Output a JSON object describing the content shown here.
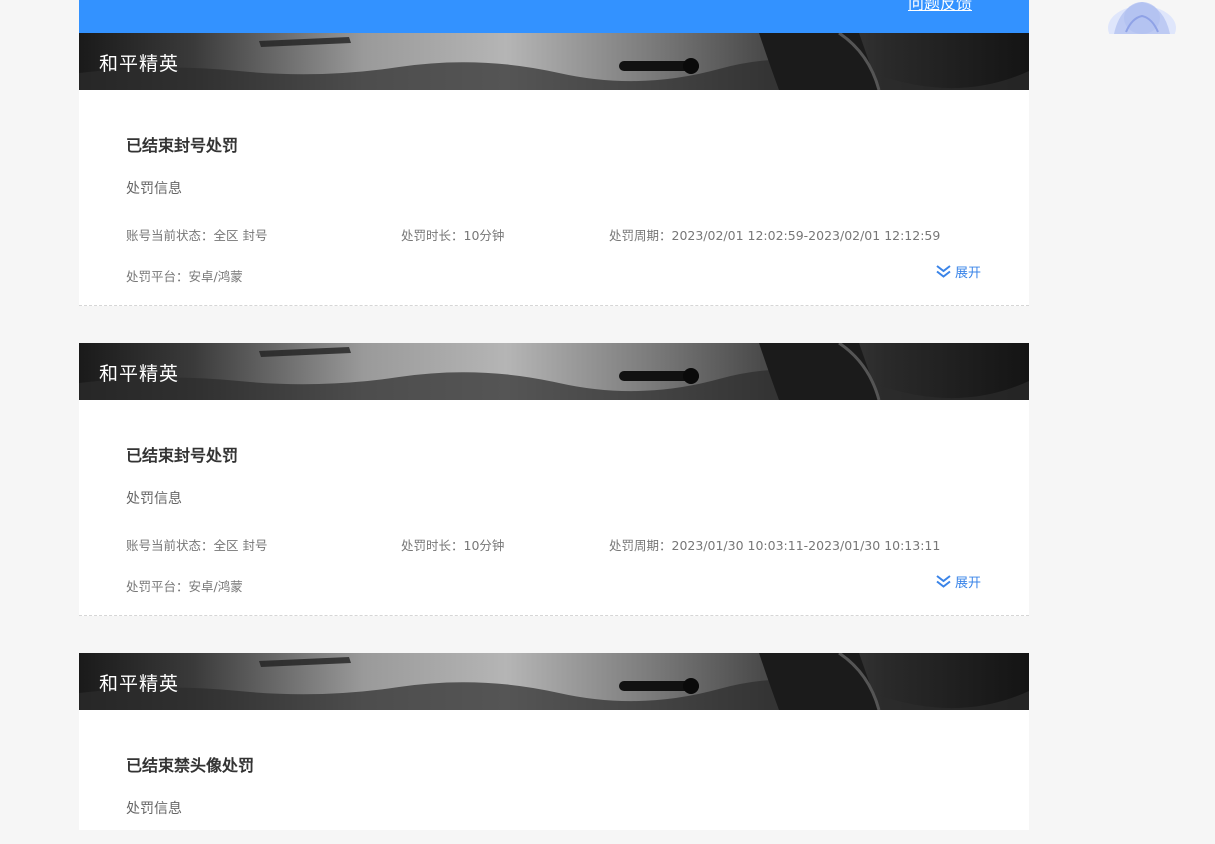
{
  "header": {
    "feedback_link": "问题反馈"
  },
  "records": [
    {
      "game": "和平精英",
      "title": "已结束封号处罚",
      "section_label": "处罚信息",
      "status": "账号当前状态：全区 封号",
      "duration": "处罚时长：10分钟",
      "period": "处罚周期：2023/02/01 12:02:59-2023/02/01 12:12:59",
      "platform": "处罚平台：安卓/鸿蒙",
      "expand_label": "展开"
    },
    {
      "game": "和平精英",
      "title": "已结束封号处罚",
      "section_label": "处罚信息",
      "status": "账号当前状态：全区 封号",
      "duration": "处罚时长：10分钟",
      "period": "处罚周期：2023/01/30 10:03:11-2023/01/30 10:13:11",
      "platform": "处罚平台：安卓/鸿蒙",
      "expand_label": "展开"
    },
    {
      "game": "和平精英",
      "title": "已结束禁头像处罚",
      "section_label": "处罚信息"
    }
  ],
  "colors": {
    "accent": "#3392ff",
    "link": "#3a84e8"
  }
}
